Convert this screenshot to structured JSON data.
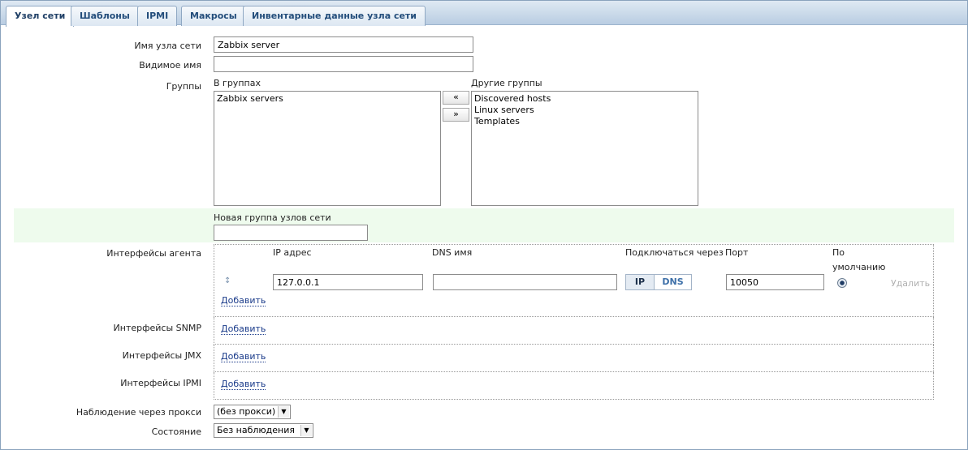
{
  "tabs": [
    {
      "label": "Узел сети",
      "active": true
    },
    {
      "label": "Шаблоны"
    },
    {
      "label": "IPMI"
    },
    {
      "label": "Макросы"
    },
    {
      "label": "Инвентарные данные узла сети"
    }
  ],
  "form": {
    "host_name": {
      "label": "Имя узла сети",
      "value": "Zabbix server"
    },
    "visible_name": {
      "label": "Видимое имя",
      "value": ""
    },
    "groups": {
      "label": "Группы",
      "in_groups_caption": "В группах",
      "in_groups": [
        "Zabbix servers"
      ],
      "other_groups_caption": "Другие группы",
      "other_groups": [
        "Discovered hosts",
        "Linux servers",
        "Templates"
      ],
      "move_left": "«",
      "move_right": "»"
    },
    "new_group": {
      "label": "Новая группа узлов сети",
      "value": ""
    },
    "agent_interfaces": {
      "label": "Интерфейсы агента",
      "col_ip": "IP адрес",
      "col_dns": "DNS имя",
      "col_connect": "Подключаться через",
      "col_port": "Порт",
      "col_default_1": "По",
      "col_default_2": "умолчанию",
      "row": {
        "ip": "127.0.0.1",
        "dns": "",
        "connect_ip": "IP",
        "connect_dns": "DNS",
        "port": "10050",
        "remove": "Удалить"
      },
      "add": "Добавить"
    },
    "snmp_interfaces": {
      "label": "Интерфейсы SNMP",
      "add": "Добавить"
    },
    "jmx_interfaces": {
      "label": "Интерфейсы JMX",
      "add": "Добавить"
    },
    "ipmi_interfaces": {
      "label": "Интерфейсы IPMI",
      "add": "Добавить"
    },
    "proxy": {
      "label": "Наблюдение через прокси",
      "value": "(без прокси)"
    },
    "status": {
      "label": "Состояние",
      "value": "Без наблюдения"
    }
  }
}
